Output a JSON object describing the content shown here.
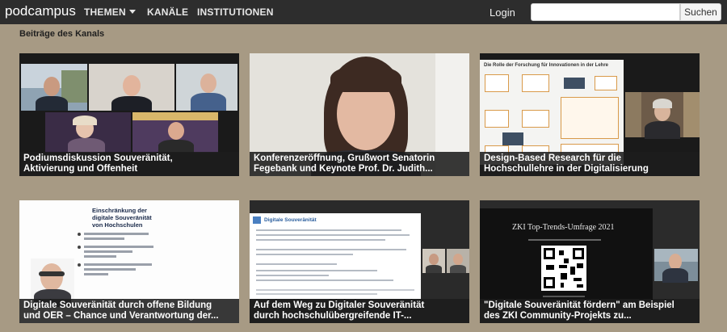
{
  "nav": {
    "brand": "podcampus",
    "items": [
      "THEMEN",
      "KANÄLE",
      "INSTITUTIONEN"
    ],
    "login": "Login",
    "search_placeholder": "",
    "search_button": "Suchen"
  },
  "section_title": "Beiträge des Kanals",
  "tiles": [
    {
      "caption_1": "Podiumsdiskussion Souveränität,",
      "caption_2": "Aktivierung und Offenheit"
    },
    {
      "caption_1": "Konferenzeröffnung, Grußwort Senatorin",
      "caption_2": "Fegebank und Keynote Prof. Dr. Judith..."
    },
    {
      "caption_1": "Design-Based Research für die",
      "caption_2": "Hochschullehre in der Digitalisierung",
      "slide_title": "Die Rolle der Forschung für Innovationen in der Lehre"
    },
    {
      "caption_1": "Digitale Souveränität durch offene Bildung",
      "caption_2": "und OER – Chance und Verantwortung der...",
      "slide_heading_1": "Einschränkung der",
      "slide_heading_2": "digitale Souveränität",
      "slide_heading_3": "von Hochschulen"
    },
    {
      "caption_1": "Auf dem Weg zu Digitaler Souveränität",
      "caption_2": "durch hochschulübergreifende IT-...",
      "slide_title": "Digitale Souveränität"
    },
    {
      "caption_1": "\"Digitale Souveränität fördern\" am Beispiel",
      "caption_2": "des ZKI Community-Projekts zu...",
      "slide_title": "ZKI Top-Trends-Umfrage 2021"
    }
  ],
  "colors": {
    "navbar": "#2d2d2d",
    "page_bg": "#a79a84",
    "caption_bg": "#1c1c1c"
  }
}
